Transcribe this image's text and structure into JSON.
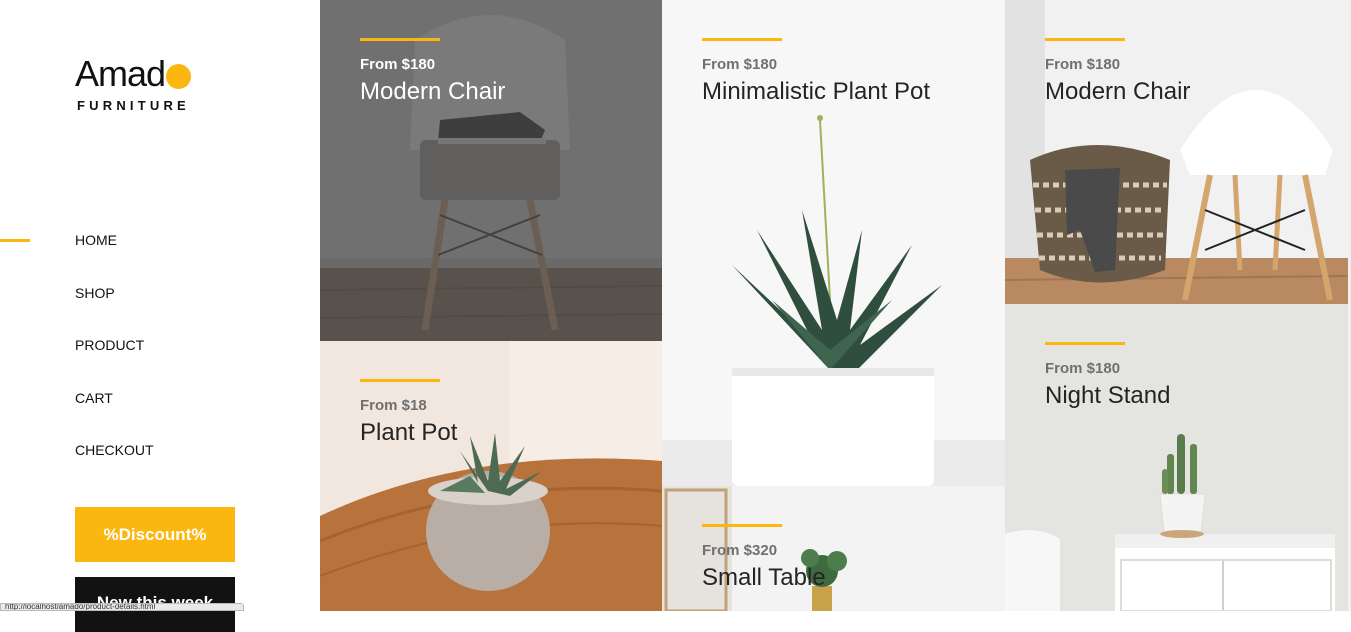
{
  "brand": {
    "name": "Amad",
    "tagline": "FURNITURE"
  },
  "colors": {
    "accent": "#fbb710",
    "dark": "#131212",
    "text": "#242424",
    "price": "#707070"
  },
  "nav": [
    {
      "label": "HOME",
      "active": true
    },
    {
      "label": "SHOP",
      "active": false
    },
    {
      "label": "PRODUCT",
      "active": false
    },
    {
      "label": "CART",
      "active": false
    },
    {
      "label": "CHECKOUT",
      "active": false
    }
  ],
  "buttons": {
    "discount": "%Discount%",
    "new_this_week": "New this week"
  },
  "status_bar": {
    "text": "http://localhost/amado/product-details.html"
  },
  "products": [
    {
      "price": "From $180",
      "name": "Modern Chair",
      "image": "chair-with-sneakers"
    },
    {
      "price": "From $18",
      "name": "Plant Pot",
      "image": "succulent-on-table"
    },
    {
      "price": "From $180",
      "name": "Minimalistic Plant Pot",
      "image": "aloe-in-white-pot"
    },
    {
      "price": "From $320",
      "name": "Small Table",
      "image": "plant-on-small-table"
    },
    {
      "price": "From $180",
      "name": "Modern Chair",
      "image": "basket-and-white-chair"
    },
    {
      "price": "From $180",
      "name": "Night Stand",
      "image": "cactus-on-nightstand"
    }
  ]
}
